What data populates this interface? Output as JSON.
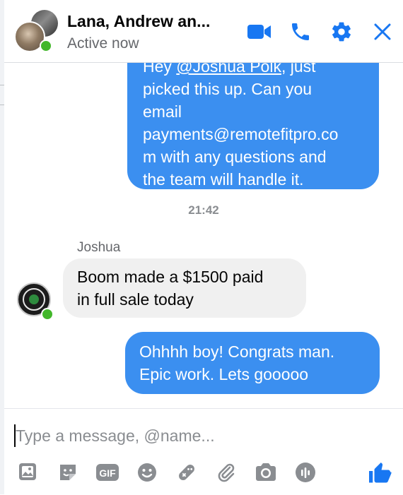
{
  "colors": {
    "accent": "#3b8ff0",
    "icon": "#1877f2",
    "toolbar_icon": "#8a8d91",
    "online": "#42b72a",
    "incoming_bubble": "#f0f0f0"
  },
  "header": {
    "title": "Lana, Andrew an...",
    "status": "Active now",
    "actions": [
      {
        "name": "video-call",
        "icon": "video-camera-icon"
      },
      {
        "name": "voice-call",
        "icon": "phone-icon"
      },
      {
        "name": "settings",
        "icon": "gear-icon"
      },
      {
        "name": "close",
        "icon": "close-icon"
      }
    ]
  },
  "messages": [
    {
      "direction": "outgoing",
      "lines": [
        {
          "prefix": "Hey ",
          "mention": "@Joshua Polk",
          "suffix": ", just"
        },
        {
          "text": "picked this up. Can you"
        },
        {
          "text": "email"
        },
        {
          "text": "payments@remotefitpro.co"
        },
        {
          "text": "m with any questions and"
        },
        {
          "text": "the team will handle it."
        }
      ]
    },
    {
      "type": "timestamp",
      "text": "21:42"
    },
    {
      "direction": "incoming",
      "sender": "Joshua",
      "lines": [
        {
          "text": "Boom made a $1500 paid"
        },
        {
          "text": "in full sale today"
        }
      ]
    },
    {
      "direction": "outgoing",
      "lines": [
        {
          "text": "Ohhhh boy! Congrats man."
        },
        {
          "text": "Epic work. Lets gooooo"
        }
      ]
    }
  ],
  "composer": {
    "placeholder": "Type a message, @name...",
    "value": "",
    "tools": [
      {
        "name": "add-photo",
        "icon": "image-icon"
      },
      {
        "name": "sticker",
        "icon": "sticker-icon"
      },
      {
        "name": "gif",
        "icon": "gif-icon",
        "label": "GIF"
      },
      {
        "name": "emoji",
        "icon": "emoji-icon"
      },
      {
        "name": "games",
        "icon": "game-controller-icon"
      },
      {
        "name": "attach-file",
        "icon": "paperclip-icon"
      },
      {
        "name": "camera",
        "icon": "camera-icon"
      },
      {
        "name": "voice-clip",
        "icon": "audio-clip-icon"
      }
    ],
    "like_icon": "thumbs-up-icon"
  }
}
